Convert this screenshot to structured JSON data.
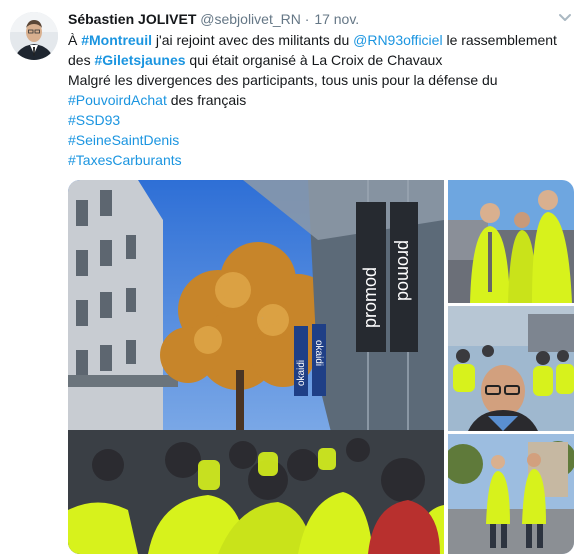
{
  "tweet": {
    "author": {
      "display_name": "Sébastien JOLIVET",
      "handle": "@sebjolivet_RN",
      "separator": "·",
      "time": "17 nov."
    },
    "lines": [
      [
        {
          "t": "À ",
          "k": "text"
        },
        {
          "t": "#Montreuil",
          "k": "tag-bold"
        },
        {
          "t": " j'ai rejoint avec des militants du ",
          "k": "text"
        },
        {
          "t": "@RN93officiel",
          "k": "mention"
        },
        {
          "t": " le rassemblement",
          "k": "text"
        }
      ],
      [
        {
          "t": "des ",
          "k": "text"
        },
        {
          "t": "#Giletsjaunes",
          "k": "tag-bold"
        },
        {
          "t": " qui était organisé à La Croix de Chavaux",
          "k": "text"
        }
      ],
      [
        {
          "t": "Malgré les divergences des participants, tous unis pour la défense du",
          "k": "text"
        }
      ],
      [
        {
          "t": "#PouvoirdAchat",
          "k": "tag"
        },
        {
          "t": " des français",
          "k": "text"
        }
      ],
      [
        {
          "t": "#SSD93",
          "k": "tag"
        }
      ],
      [
        {
          "t": "#SeineSaintDenis",
          "k": "tag"
        }
      ],
      [
        {
          "t": "#TaxesCarburants",
          "k": "tag"
        }
      ]
    ],
    "media": {
      "photos": [
        {
          "name": "photo-crowd-promod",
          "sign_texts": [
            "promod",
            "promod",
            "okaidi",
            "okaidi"
          ]
        },
        {
          "name": "photo-group-vests"
        },
        {
          "name": "photo-selfie-crowd"
        },
        {
          "name": "photo-two-men-street"
        }
      ]
    },
    "colors": {
      "link": "#1b95e0",
      "text": "#14171a",
      "secondary": "#657786",
      "vest": "#d7f21c"
    },
    "icons": [
      "chevron-down-icon"
    ]
  }
}
